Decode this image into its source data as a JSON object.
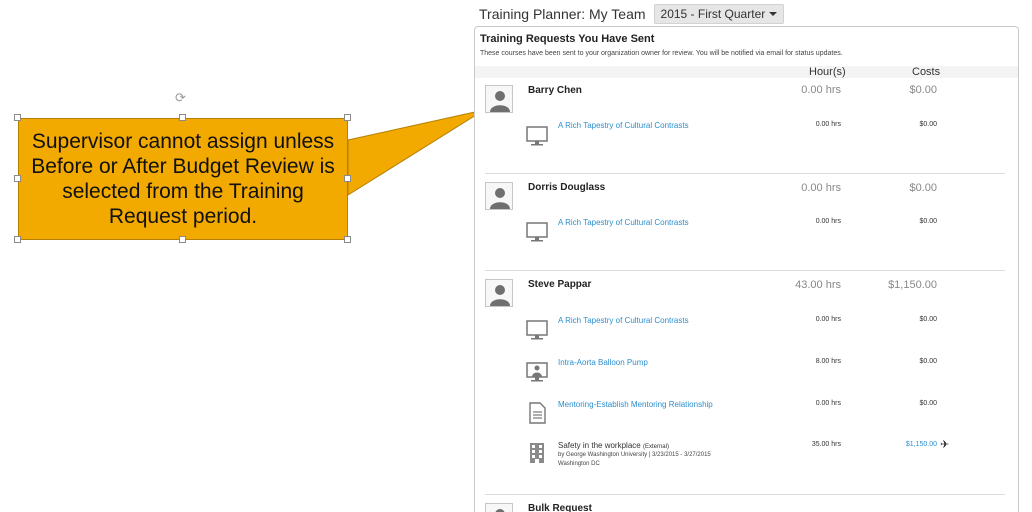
{
  "callout": {
    "text": "Supervisor cannot assign unless Before or After Budget Review is selected from the Training Request period.",
    "fill_color": "#f2a900"
  },
  "header": {
    "title": "Training Planner: My Team",
    "period": "2015 - First Quarter"
  },
  "panel": {
    "title": "Training Requests You Have Sent",
    "description": "These courses have been sent to your organization owner for review. You will be notified via email for status updates.",
    "col_hours": "Hour(s)",
    "col_costs": "Costs"
  },
  "people": [
    {
      "name": "Barry Chen",
      "hours": "0.00 hrs",
      "cost": "$0.00",
      "courses": [
        {
          "icon": "monitor-icon",
          "name": "A Rich Tapestry of Cultural Contrasts",
          "hours": "0.00 hrs",
          "cost": "$0.00"
        }
      ]
    },
    {
      "name": "Dorris Douglass",
      "hours": "0.00 hrs",
      "cost": "$0.00",
      "courses": [
        {
          "icon": "monitor-icon",
          "name": "A Rich Tapestry of Cultural Contrasts",
          "hours": "0.00 hrs",
          "cost": "$0.00"
        }
      ]
    },
    {
      "name": "Steve Pappar",
      "hours": "43.00 hrs",
      "cost": "$1,150.00",
      "courses": [
        {
          "icon": "monitor-icon",
          "name": "A Rich Tapestry of Cultural Contrasts",
          "hours": "0.00 hrs",
          "cost": "$0.00"
        },
        {
          "icon": "presenter-icon",
          "name": "Intra-Aorta Balloon Pump",
          "hours": "8.00 hrs",
          "cost": "$0.00"
        },
        {
          "icon": "document-icon",
          "name": "Mentoring-Establish Mentoring Relationship",
          "hours": "0.00 hrs",
          "cost": "$0.00"
        },
        {
          "icon": "building-icon",
          "name": "Safety in the workplace",
          "tag": "(External)",
          "meta_line1": "by George Washington University  |  3/23/2015 - 3/27/2015",
          "meta_line2": "Washington DC",
          "hours": "35.00 hrs",
          "cost": "$1,150.00"
        }
      ]
    },
    {
      "name": "Bulk Request"
    }
  ]
}
